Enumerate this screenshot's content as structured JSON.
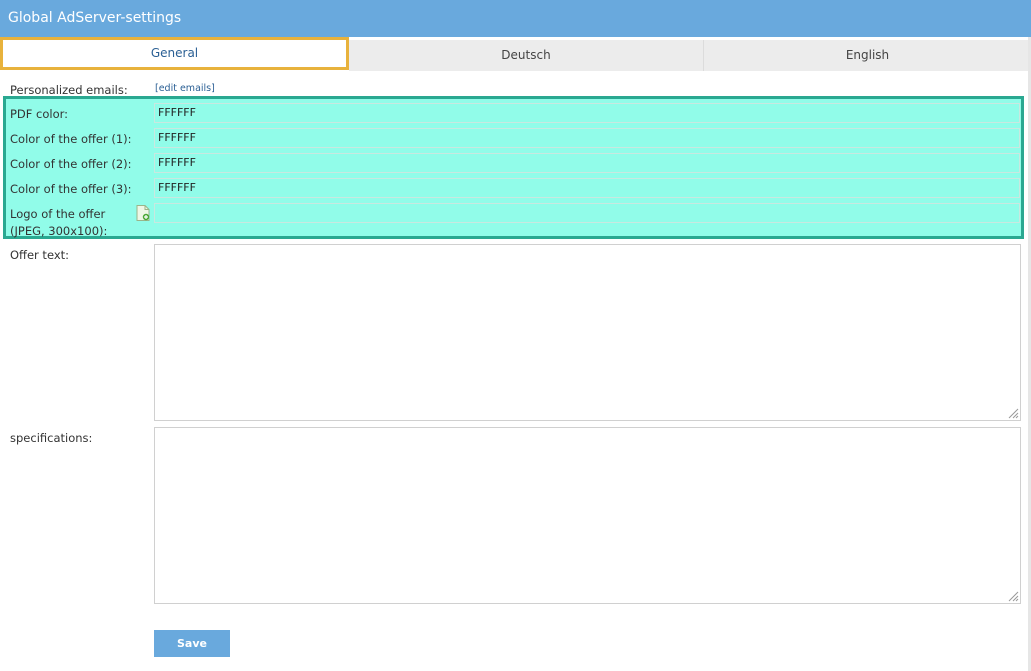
{
  "window": {
    "title": "Global AdServer-settings"
  },
  "tabs": [
    {
      "label": "General",
      "active": true
    },
    {
      "label": "Deutsch",
      "active": false
    },
    {
      "label": "English",
      "active": false
    }
  ],
  "form": {
    "personalized_emails_label": "Personalized emails:",
    "edit_emails_link": "[edit emails]",
    "pdf_color_label": "PDF color:",
    "pdf_color_value": "FFFFFF",
    "offer_color_1_label": "Color of the offer (1):",
    "offer_color_1_value": "FFFFFF",
    "offer_color_2_label": "Color of the offer (2):",
    "offer_color_2_value": "FFFFFF",
    "offer_color_3_label": "Color of the offer (3):",
    "offer_color_3_value": "FFFFFF",
    "logo_label_line1": "Logo of the offer",
    "logo_label_line2": "(JPEG, 300x100):",
    "logo_value": "",
    "offer_text_label": "Offer text:",
    "offer_text_value": "",
    "specifications_label": "specifications:",
    "specifications_value": "",
    "save_label": "Save"
  },
  "colors": {
    "header": "#69a9dd",
    "highlight_fill": "#91fce9",
    "highlight_border": "#2aa891",
    "active_tab_border": "#e8b23c"
  },
  "icons": {
    "upload": "file-upload-icon"
  }
}
